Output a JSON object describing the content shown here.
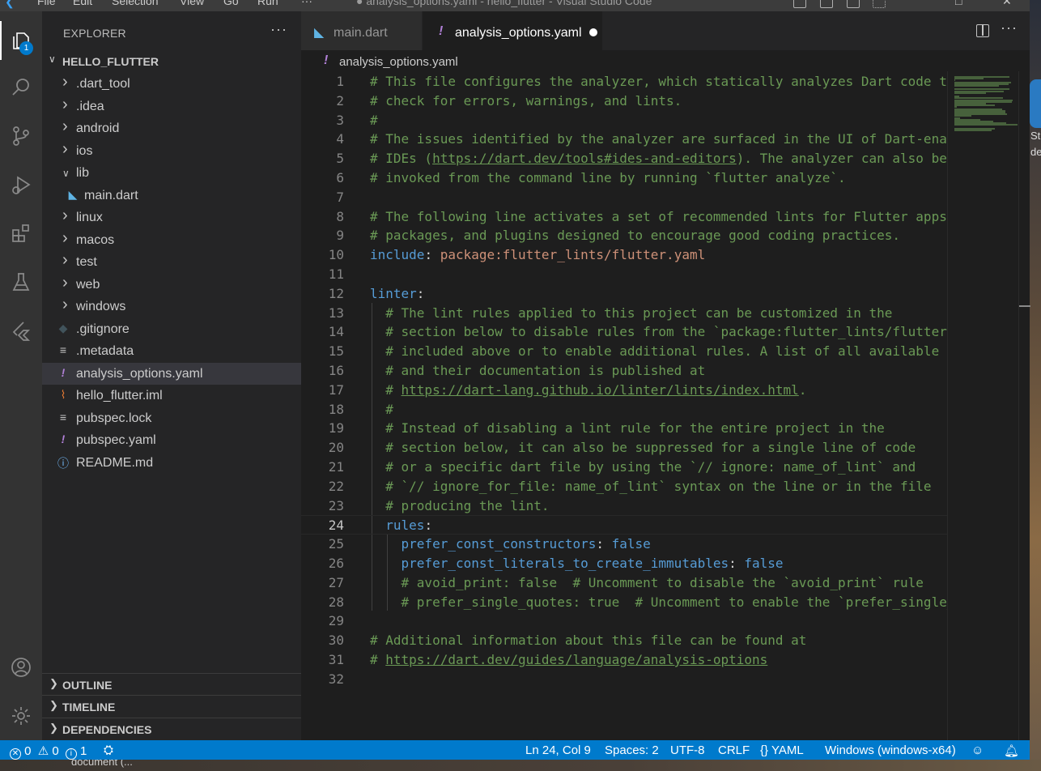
{
  "window": {
    "title": "● analysis_options.yaml - hello_flutter - Visual Studio Code",
    "menu": [
      "File",
      "Edit",
      "Selection",
      "View",
      "Go",
      "Run",
      "···"
    ]
  },
  "activity_bar": {
    "explorer_badge": "1",
    "items": [
      "explorer-icon",
      "search-icon",
      "source-control-icon",
      "run-debug-icon",
      "extensions-icon",
      "testing-icon",
      "flutter-icon",
      "accounts-icon",
      "settings-gear-icon"
    ]
  },
  "sidebar": {
    "title": "EXPLORER",
    "more": "···",
    "folder": "HELLO_FLUTTER",
    "items": [
      {
        "label": ".dart_tool",
        "type": "folder",
        "expanded": false
      },
      {
        "label": ".idea",
        "type": "folder",
        "expanded": false
      },
      {
        "label": "android",
        "type": "folder",
        "expanded": false
      },
      {
        "label": "ios",
        "type": "folder",
        "expanded": false
      },
      {
        "label": "lib",
        "type": "folder",
        "expanded": true
      },
      {
        "label": "main.dart",
        "type": "dart"
      },
      {
        "label": "linux",
        "type": "folder",
        "expanded": false
      },
      {
        "label": "macos",
        "type": "folder",
        "expanded": false
      },
      {
        "label": "test",
        "type": "folder",
        "expanded": false
      },
      {
        "label": "web",
        "type": "folder",
        "expanded": false
      },
      {
        "label": "windows",
        "type": "folder",
        "expanded": false
      },
      {
        "label": ".gitignore",
        "type": "git"
      },
      {
        "label": ".metadata",
        "type": "text"
      },
      {
        "label": "analysis_options.yaml",
        "type": "yaml",
        "selected": true
      },
      {
        "label": "hello_flutter.iml",
        "type": "rss"
      },
      {
        "label": "pubspec.lock",
        "type": "text"
      },
      {
        "label": "pubspec.yaml",
        "type": "yaml"
      },
      {
        "label": "README.md",
        "type": "info"
      }
    ],
    "sections": [
      "OUTLINE",
      "TIMELINE",
      "DEPENDENCIES"
    ]
  },
  "tabs": [
    {
      "label": "main.dart",
      "active": false
    },
    {
      "label": "analysis_options.yaml",
      "active": true,
      "dirty": true
    }
  ],
  "breadcrumb": "analysis_options.yaml",
  "editor": {
    "current_line": 24,
    "lines": [
      [
        [
          "c",
          "# This file configures the analyzer, which statically analyzes Dart code to"
        ]
      ],
      [
        [
          "c",
          "# check for errors, warnings, and lints."
        ]
      ],
      [
        [
          "c",
          "#"
        ]
      ],
      [
        [
          "c",
          "# The issues identified by the analyzer are surfaced in the UI of Dart-enabled"
        ]
      ],
      [
        [
          "c",
          "# IDEs ("
        ],
        [
          "u",
          "https://dart.dev/tools#ides-and-editors"
        ],
        [
          "c",
          "). The analyzer can also be"
        ]
      ],
      [
        [
          "c",
          "# invoked from the command line by running `flutter analyze`."
        ]
      ],
      [],
      [
        [
          "c",
          "# The following line activates a set of recommended lints for Flutter apps,"
        ]
      ],
      [
        [
          "c",
          "# packages, and plugins designed to encourage good coding practices."
        ]
      ],
      [
        [
          "k",
          "include"
        ],
        [
          "p",
          ": "
        ],
        [
          "s",
          "package:flutter_lints/flutter.yaml"
        ]
      ],
      [],
      [
        [
          "k",
          "linter"
        ],
        [
          "p",
          ":"
        ]
      ],
      [
        [
          "p",
          "  "
        ],
        [
          "c",
          "# The lint rules applied to this project can be customized in the"
        ]
      ],
      [
        [
          "p",
          "  "
        ],
        [
          "c",
          "# section below to disable rules from the `package:flutter_lints/flutter.yaml`"
        ]
      ],
      [
        [
          "p",
          "  "
        ],
        [
          "c",
          "# included above or to enable additional rules. A list of all available lints"
        ]
      ],
      [
        [
          "p",
          "  "
        ],
        [
          "c",
          "# and their documentation is published at"
        ]
      ],
      [
        [
          "p",
          "  "
        ],
        [
          "c",
          "# "
        ],
        [
          "u",
          "https://dart-lang.github.io/linter/lints/index.html"
        ],
        [
          "c",
          "."
        ]
      ],
      [
        [
          "p",
          "  "
        ],
        [
          "c",
          "#"
        ]
      ],
      [
        [
          "p",
          "  "
        ],
        [
          "c",
          "# Instead of disabling a lint rule for the entire project in the"
        ]
      ],
      [
        [
          "p",
          "  "
        ],
        [
          "c",
          "# section below, it can also be suppressed for a single line of code"
        ]
      ],
      [
        [
          "p",
          "  "
        ],
        [
          "c",
          "# or a specific dart file by using the `// ignore: name_of_lint` and"
        ]
      ],
      [
        [
          "p",
          "  "
        ],
        [
          "c",
          "# `// ignore_for_file: name_of_lint` syntax on the line or in the file"
        ]
      ],
      [
        [
          "p",
          "  "
        ],
        [
          "c",
          "# producing the lint."
        ]
      ],
      [
        [
          "p",
          "  "
        ],
        [
          "k",
          "rules"
        ],
        [
          "p",
          ":"
        ]
      ],
      [
        [
          "p",
          "    "
        ],
        [
          "k",
          "prefer_const_constructors"
        ],
        [
          "p",
          ": "
        ],
        [
          "b",
          "false"
        ]
      ],
      [
        [
          "p",
          "    "
        ],
        [
          "k",
          "prefer_const_literals_to_create_immutables"
        ],
        [
          "p",
          ": "
        ],
        [
          "b",
          "false"
        ]
      ],
      [
        [
          "p",
          "    "
        ],
        [
          "c",
          "# avoid_print: false  # Uncomment to disable the `avoid_print` rule"
        ]
      ],
      [
        [
          "p",
          "    "
        ],
        [
          "c",
          "# prefer_single_quotes: true  # Uncomment to enable the `prefer_single_quotes` rule"
        ]
      ],
      [],
      [
        [
          "c",
          "# Additional information about this file can be found at"
        ]
      ],
      [
        [
          "c",
          "# "
        ],
        [
          "u",
          "https://dart.dev/guides/language/analysis-options"
        ]
      ],
      []
    ]
  },
  "status_bar": {
    "errors": "0",
    "warnings": "0",
    "infos": "1",
    "cursor": "Ln 24, Col 9",
    "spaces": "Spaces: 2",
    "encoding": "UTF-8",
    "eol": "CRLF",
    "language": "YAML",
    "platform": "Windows (windows-x64)"
  },
  "desktop": {
    "right_fragment_1": "St",
    "right_fragment_2": "de",
    "taskbar_label": "document (..."
  },
  "colors": {
    "accent": "#007acc",
    "comment": "#6a9955",
    "keyword": "#569cd6",
    "string": "#ce9178",
    "yaml_icon": "#b180d7",
    "dart_icon": "#5fb3e3"
  }
}
